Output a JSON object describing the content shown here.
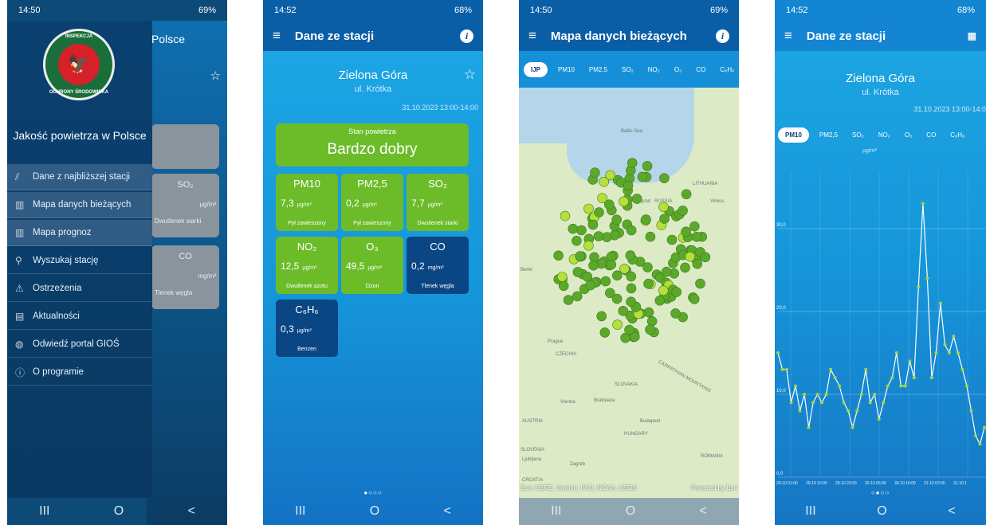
{
  "screen1": {
    "status": {
      "time": "14:50",
      "battery": "69%"
    },
    "logo": {
      "top": "INSPEKCJA",
      "bottom": "OCHRONY ŚRODOWISKA",
      "emblem": "eagle-icon"
    },
    "title": "Jakość powietrza w Polsce",
    "behind": {
      "title": "Polsce",
      "so2": "SO₂",
      "so2_unit": "µg/m³",
      "so2_desc": "Dwutlenek siarki",
      "co": "CO",
      "co_unit": "mg/m³",
      "co_desc": "Tlenek węgla",
      "dots": "..."
    },
    "menu": [
      {
        "label": "Dane z najbliższej stacji",
        "icon": "station-icon",
        "selected": true
      },
      {
        "label": "Mapa danych bieżących",
        "icon": "map-icon",
        "selected": true
      },
      {
        "label": "Mapa prognoz",
        "icon": "map-forecast-icon",
        "selected": true
      },
      {
        "label": "Wyszukaj stację",
        "icon": "search-icon",
        "selected": false
      },
      {
        "label": "Ostrzeżenia",
        "icon": "warning-icon",
        "selected": false
      },
      {
        "label": "Aktualności",
        "icon": "news-icon",
        "selected": false
      },
      {
        "label": "Odwiedź portal GIOŚ",
        "icon": "globe-icon",
        "selected": false
      },
      {
        "label": "O programie",
        "icon": "about-icon",
        "selected": false
      }
    ]
  },
  "screen2": {
    "status": {
      "time": "14:52",
      "battery": "68%"
    },
    "app_title": "Dane ze stacji",
    "city": "Zielona Góra",
    "street": "ul. Krótka",
    "date": "31.10.2023 13:00-14:00",
    "state_label": "Stan powietrza",
    "state_value": "Bardzo dobry",
    "tiles": [
      {
        "name": "PM10",
        "value": "7,3",
        "unit": "µg/m³",
        "desc": "Pył zawieszony",
        "color": "#6cbc2a"
      },
      {
        "name": "PM2,5",
        "value": "0,2",
        "unit": "µg/m³",
        "desc": "Pył zawieszony",
        "color": "#6cbc2a"
      },
      {
        "name": "SO₂",
        "value": "7,7",
        "unit": "µg/m³",
        "desc": "Dwutlenek siarki",
        "color": "#6cbc2a"
      },
      {
        "name": "NO₂",
        "value": "12,5",
        "unit": "µg/m³",
        "desc": "Dwutlenek azotu",
        "color": "#6cbc2a"
      },
      {
        "name": "O₃",
        "value": "49,5",
        "unit": "µg/m³",
        "desc": "Ozon",
        "color": "#6cbc2a"
      },
      {
        "name": "CO",
        "value": "0,2",
        "unit": "mg/m³",
        "desc": "Tlenek węgla",
        "color": "#0b4684"
      },
      {
        "name": "C₆H₆",
        "value": "0,3",
        "unit": "µg/m³",
        "desc": "Benzen",
        "color": "#0b4684"
      }
    ],
    "pager": "●○○○"
  },
  "screen3": {
    "status": {
      "time": "14:50",
      "battery": "69%"
    },
    "app_title": "Mapa danych bieżących",
    "chips": [
      "IJP",
      "PM10",
      "PM2,5",
      "SO₂",
      "NO₂",
      "O₃",
      "CO",
      "C₆H₆"
    ],
    "map_labels": [
      "Baltic Sea",
      "LITHUANIA",
      "RUSSIA",
      "Kaliningrad",
      "Vilnius",
      "Berlin",
      "Prague",
      "CZECHIA",
      "SLOVAKIA",
      "Vienna",
      "Bratislava",
      "AUSTRIA",
      "Budapest",
      "HUNGARY",
      "SLOVENIA",
      "Ljubljana",
      "Zagreb",
      "CROATIA",
      "ROMANIA",
      "CARPATHIAN MOUNTAINS"
    ],
    "attribution": "Esri, HERE, Garmin, FAO, NOAA, USGS",
    "powered": "Powered by Esri"
  },
  "screen4": {
    "status": {
      "time": "14:52",
      "battery": "68%"
    },
    "app_title": "Dane ze stacji",
    "city": "Zielona Góra",
    "street": "ul. Krótka",
    "date": "31.10.2023 13:00-14:0",
    "chips": [
      "PM10",
      "PM2,5",
      "SO₂",
      "NO₂",
      "O₃",
      "CO",
      "C₆H₆"
    ],
    "unit": "µg/m³",
    "pager": "○●○○",
    "chart_data": {
      "type": "line",
      "y_ticks": [
        "0,0",
        "10,0",
        "20,0",
        "30,0"
      ],
      "ylim": [
        0,
        37
      ],
      "x_ticks": [
        "29-10 01:00",
        "29-10 10:00",
        "29-10 20:00",
        "30-10 06:00",
        "30-10 16:00",
        "31-10 02:00",
        "31-10 1"
      ],
      "values": [
        15,
        13,
        13,
        9,
        11,
        8,
        10,
        6,
        9,
        10,
        9,
        10,
        13,
        12,
        11,
        9,
        8,
        6,
        8,
        10,
        13,
        9,
        10,
        7,
        9,
        11,
        12,
        15,
        11,
        11,
        14,
        12,
        23,
        33,
        24,
        12,
        15,
        21,
        16,
        15,
        17,
        15,
        13,
        11,
        8,
        5,
        4,
        6
      ]
    }
  },
  "nav": {
    "recent": "III",
    "home": "O",
    "back": "<"
  }
}
